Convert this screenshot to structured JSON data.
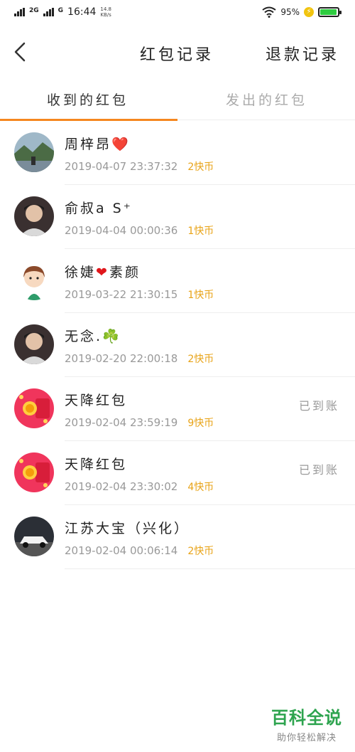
{
  "status_bar": {
    "network_1": "2G",
    "network_2": "G",
    "time": "16:44",
    "speed_value": "14.8",
    "speed_unit": "KB/s",
    "battery_percent": "95%",
    "battery_level": 0.95
  },
  "nav": {
    "title": "红包记录",
    "refund_link": "退款记录"
  },
  "tabs": [
    {
      "label": "收到的红包",
      "active": true
    },
    {
      "label": "发出的红包",
      "active": false
    }
  ],
  "records": [
    {
      "name": "周梓昂",
      "emoji": "❤️",
      "datetime": "2019-04-07  23:37:32",
      "amount": "2快币",
      "status": "",
      "avatar_icon": "landscape-photo-avatar"
    },
    {
      "name": "俞叔a S⁺",
      "emoji": "",
      "datetime": "2019-04-04  00:00:36",
      "amount": "1快币",
      "status": "",
      "avatar_icon": "person-photo-avatar"
    },
    {
      "name": "徐婕",
      "emoji": "❤",
      "name_suffix": "素颜",
      "datetime": "2019-03-22  21:30:15",
      "amount": "1快币",
      "status": "",
      "avatar_icon": "cartoon-girl-avatar"
    },
    {
      "name": "无念.",
      "emoji": "☘️",
      "datetime": "2019-02-20  22:00:18",
      "amount": "2快币",
      "status": "",
      "avatar_icon": "person-photo-avatar"
    },
    {
      "name": "天降红包",
      "emoji": "",
      "datetime": "2019-02-04  23:59:19",
      "amount": "9快币",
      "status": "已到账",
      "avatar_icon": "red-packet-avatar"
    },
    {
      "name": "天降红包",
      "emoji": "",
      "datetime": "2019-02-04  23:30:02",
      "amount": "4快币",
      "status": "已到账",
      "avatar_icon": "red-packet-avatar"
    },
    {
      "name": "江苏大宝（兴化）",
      "emoji": "",
      "datetime": "2019-02-04  00:06:14",
      "amount": "2快币",
      "status": "",
      "avatar_icon": "car-photo-avatar"
    }
  ],
  "watermark": {
    "main": "百科全说",
    "sub": "助你轻松解决"
  },
  "colors": {
    "accent": "#f5871f",
    "amount": "#e8a317",
    "watermark": "#2ea44f"
  }
}
